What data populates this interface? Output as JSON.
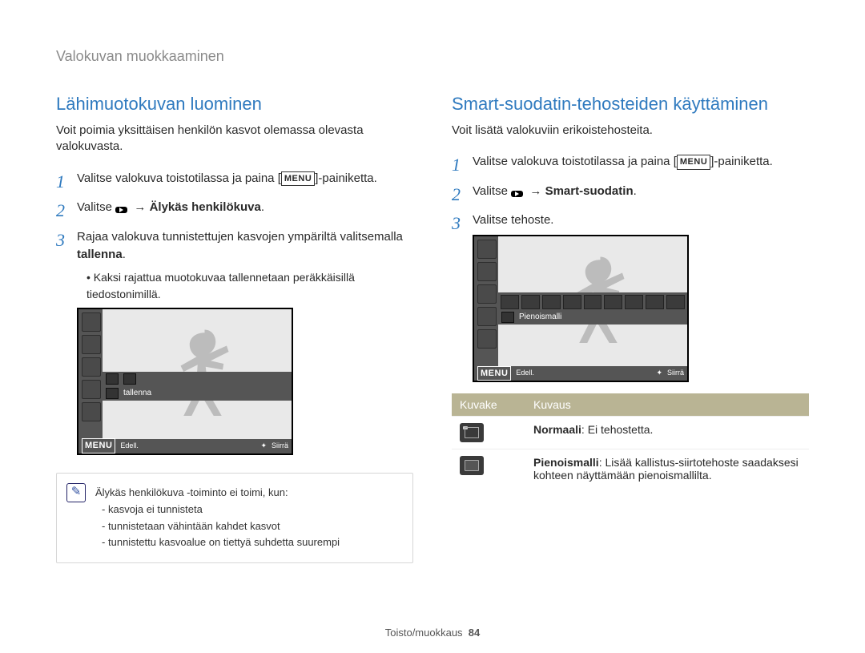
{
  "breadcrumb": "Valokuvan muokkaaminen",
  "left": {
    "heading": "Lähimuotokuvan luominen",
    "lead": "Voit poimia yksittäisen henkilön kasvot olemassa olevasta valokuvasta.",
    "step1_pre": "Valitse valokuva toistotilassa ja paina [",
    "menu_chip": "MENU",
    "step1_post": "]-painiketta.",
    "step2_pre": "Valitse ",
    "step2_link": "Älykäs henkilökuva",
    "step3_a": "Rajaa valokuva tunnistettujen kasvojen ympäriltä valitsemalla ",
    "step3_b": "tallenna",
    "step3_c": ".",
    "bullet": "Kaksi rajattua muotokuvaa tallennetaan peräkkäisillä tiedostonimillä.",
    "screen": {
      "label": "tallenna",
      "back": "Edell.",
      "move": "Siirrä"
    },
    "note_intro": "Älykäs henkilökuva -toiminto ei toimi, kun:",
    "note_items": [
      "kasvoja ei tunnisteta",
      "tunnistetaan vähintään kahdet kasvot",
      "tunnistettu kasvoalue on tiettyä suhdetta suurempi"
    ]
  },
  "right": {
    "heading": "Smart-suodatin-tehosteiden käyttäminen",
    "lead": "Voit lisätä valokuviin erikoistehosteita.",
    "step1_pre": "Valitse valokuva toistotilassa ja paina [",
    "step1_post": "]-painiketta.",
    "step2_pre": "Valitse ",
    "step2_link": "Smart-suodatin",
    "step3": "Valitse tehoste.",
    "screen": {
      "label": "Pienoismalli",
      "back": "Edell.",
      "move": "Siirrä"
    },
    "table": {
      "h1": "Kuvake",
      "h2": "Kuvaus",
      "r1_bold": "Normaali",
      "r1_rest": ": Ei tehostetta.",
      "r2_bold": "Pienoismalli",
      "r2_rest": ": Lisää kallistus-siirtotehoste saadaksesi kohteen näyttämään pienoismallilta."
    }
  },
  "footer": {
    "section": "Toisto/muokkaus",
    "page": "84"
  }
}
